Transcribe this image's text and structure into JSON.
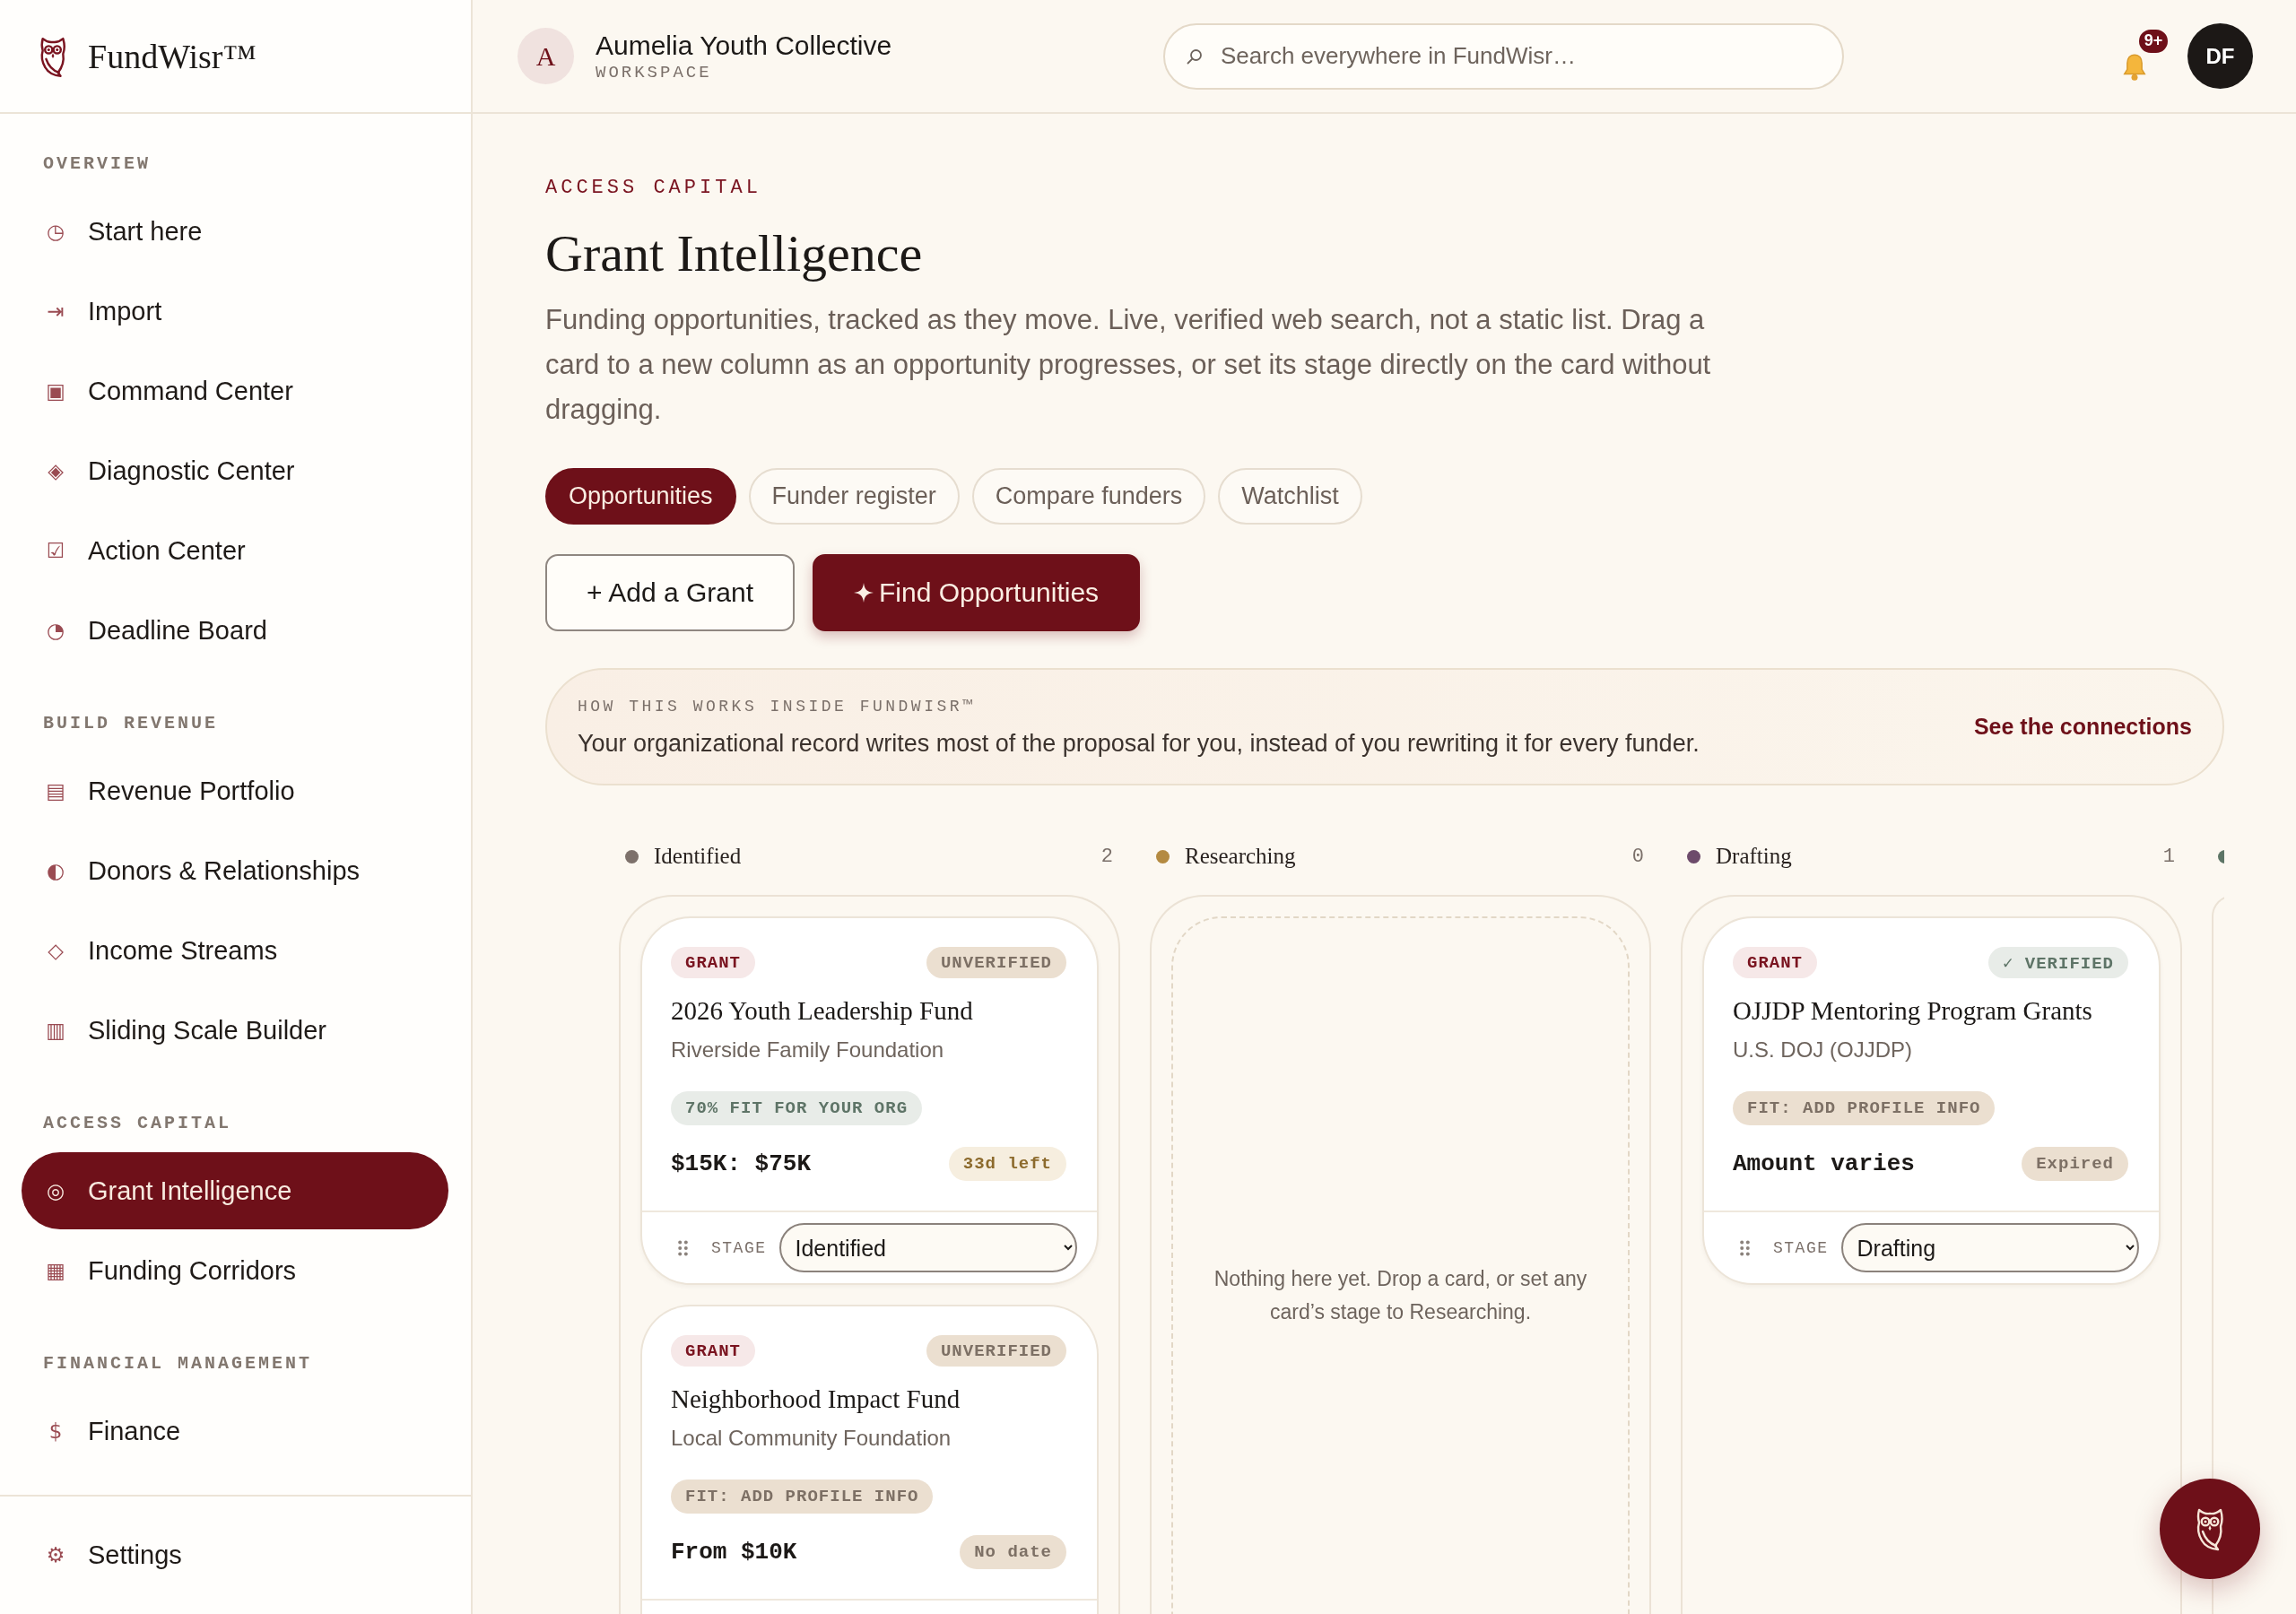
{
  "sidebar": {
    "brand": "FundWisr™",
    "sections": [
      {
        "title": "OVERVIEW",
        "items": [
          {
            "icon": "◷",
            "label": "Start here",
            "selected": false
          },
          {
            "icon": "⇥",
            "label": "Import",
            "selected": false
          },
          {
            "icon": "▣",
            "label": "Command Center",
            "selected": false
          },
          {
            "icon": "◈",
            "label": "Diagnostic Center",
            "selected": false
          },
          {
            "icon": "☑",
            "label": "Action Center",
            "selected": false
          },
          {
            "icon": "◔",
            "label": "Deadline Board",
            "selected": false
          }
        ]
      },
      {
        "title": "BUILD REVENUE",
        "items": [
          {
            "icon": "▤",
            "label": "Revenue Portfolio",
            "selected": false
          },
          {
            "icon": "◐",
            "label": "Donors & Relationships",
            "selected": false
          },
          {
            "icon": "◇",
            "label": "Income Streams",
            "selected": false
          },
          {
            "icon": "▥",
            "label": "Sliding Scale Builder",
            "selected": false
          }
        ]
      },
      {
        "title": "ACCESS CAPITAL",
        "items": [
          {
            "icon": "◎",
            "label": "Grant Intelligence",
            "selected": true
          },
          {
            "icon": "▦",
            "label": "Funding Corridors",
            "selected": false
          }
        ]
      },
      {
        "title": "FINANCIAL MANAGEMENT",
        "items": [
          {
            "icon": "$",
            "label": "Finance",
            "selected": false
          }
        ]
      }
    ],
    "footer_items": [
      {
        "icon": "⚙",
        "label": "Settings",
        "selected": false
      }
    ]
  },
  "header": {
    "workspace": {
      "initial": "A",
      "name": "Aumelia Youth Collective",
      "subtitle": "WORKSPACE"
    },
    "search": {
      "placeholder": "Search everywhere in FundWisr…"
    },
    "notifications": {
      "badge": "9+"
    },
    "user": {
      "initials": "DF"
    }
  },
  "page": {
    "eyebrow": "ACCESS CAPITAL",
    "title": "Grant Intelligence",
    "description": "Funding opportunities, tracked as they move. Live, verified web search, not a static list. Drag a card to a new column as an opportunity progresses, or set its stage directly on the card without dragging.",
    "tabs": [
      {
        "label": "Opportunities",
        "selected": true
      },
      {
        "label": "Funder register",
        "selected": false
      },
      {
        "label": "Compare funders",
        "selected": false
      },
      {
        "label": "Watchlist",
        "selected": false
      }
    ],
    "actions": [
      {
        "label": "+ Add a Grant",
        "kind": "secondary"
      },
      {
        "label": "Find Opportunities",
        "kind": "primary"
      }
    ],
    "banner": {
      "eyebrow": "HOW THIS WORKS INSIDE FUNDWISR™",
      "text": "Your organizational record writes most of the proposal for you, instead of you rewriting it for every funder.",
      "link": "See the connections"
    },
    "board": {
      "columns": [
        {
          "name": "Identified",
          "color": "#7d716b",
          "count": "2",
          "cards": [
            {
              "tag": "GRANT",
              "verification": {
                "label": "UNVERIFIED",
                "verified": false
              },
              "title": "2026 Youth Leadership Fund",
              "funder": "Riverside Family Foundation",
              "fit": {
                "label": "70% FIT FOR YOUR ORG",
                "kind": "score"
              },
              "amount": "$15K: $75K",
              "deadline": {
                "label": "33d left",
                "kind": "countdown"
              },
              "stage_label": "STAGE",
              "stage": "Identified"
            },
            {
              "tag": "GRANT",
              "verification": {
                "label": "UNVERIFIED",
                "verified": false
              },
              "title": "Neighborhood Impact Fund",
              "funder": "Local Community Foundation",
              "fit": {
                "label": "FIT: ADD PROFILE INFO",
                "kind": "missing"
              },
              "amount": "From $10K",
              "deadline": {
                "label": "No date",
                "kind": "none"
              }
            }
          ]
        },
        {
          "name": "Researching",
          "color": "#b48a41",
          "count": "0",
          "empty_message": "Nothing here yet. Drop a card, or set any card’s stage to Researching."
        },
        {
          "name": "Drafting",
          "color": "#6d4b6b",
          "count": "1",
          "cards": [
            {
              "tag": "GRANT",
              "verification": {
                "label": "✓ VERIFIED",
                "verified": true
              },
              "title": "OJJDP Mentoring Program Grants",
              "funder": "U.S. DOJ (OJJDP)",
              "fit": {
                "label": "FIT: ADD PROFILE INFO",
                "kind": "missing"
              },
              "amount": "Amount varies",
              "deadline": {
                "label": "Expired",
                "kind": "expired"
              },
              "stage_label": "STAGE",
              "stage": "Drafting"
            }
          ]
        },
        {
          "color": "#5d7566"
        }
      ]
    }
  }
}
